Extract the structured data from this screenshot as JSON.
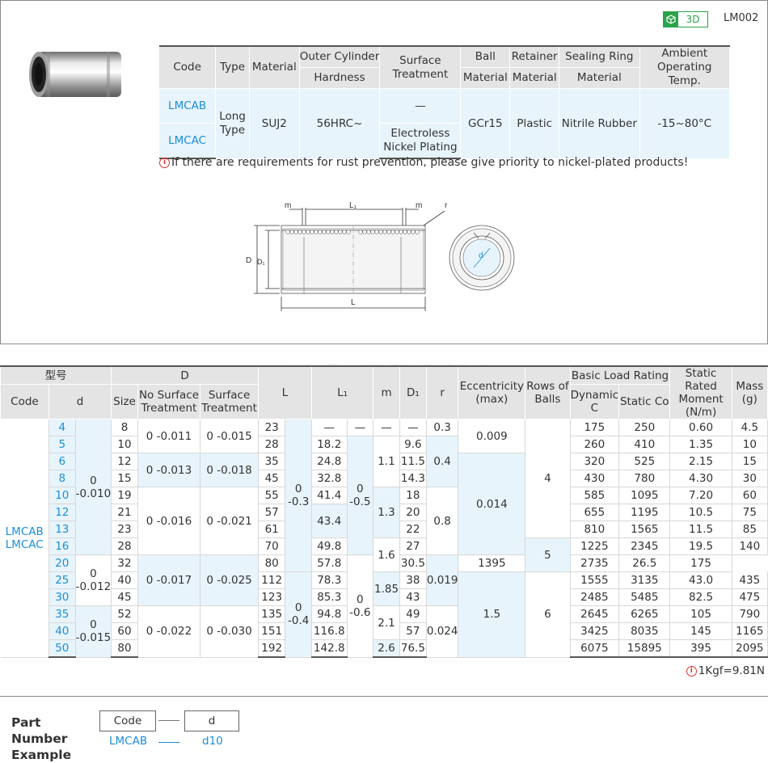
{
  "header": {
    "badge_3d": "3D",
    "product_code": "LM002"
  },
  "spec_table": {
    "headers": {
      "code": "Code",
      "type": "Type",
      "material": "Material",
      "outer_cylinder": "Outer Cylinder",
      "outer_cylinder_sub": "Hardness",
      "surface_treatment": "Surface Treatment",
      "ball": "Ball",
      "ball_sub": "Material",
      "retainer": "Retainer",
      "retainer_sub": "Material",
      "sealing_ring": "Sealing Ring",
      "sealing_ring_sub": "Material",
      "ambient": "Ambient Operating Temp."
    },
    "codes": [
      "LMCAB",
      "LMCAC"
    ],
    "type": "Long Type",
    "material": "SUJ2",
    "hardness": "56HRC~",
    "surface": [
      "—",
      "Electroless Nickel Plating"
    ],
    "ball_material": "GCr15",
    "retainer_material": "Plastic",
    "sealing_material": "Nitrile Rubber",
    "temp": "-15~80°C"
  },
  "note": {
    "icon": "info-icon",
    "text": "If there are requirements for rust prevention, please give priority to nickel-plated products!"
  },
  "drawing_labels": {
    "m": "m",
    "L1": "L₁",
    "r": "r",
    "D": "D",
    "D1": "D₁",
    "L": "L",
    "d": "d"
  },
  "main_table": {
    "headers": {
      "model": "型号",
      "D": "D",
      "code": "Code",
      "d": "d",
      "size": "Size",
      "no_surface": "No Surface Treatment",
      "surface": "Surface Treatment",
      "L": "L",
      "L1": "L₁",
      "m": "m",
      "D1": "D₁",
      "r": "r",
      "eccentricity": "Eccentricity (max)",
      "rows": "Rows of Balls",
      "basic_load": "Basic Load Rating",
      "dynamic": "Dynamic C",
      "static": "Static Co",
      "moment": "Static Rated Moment (N/m)",
      "mass": "Mass (g)"
    },
    "code_label": "LMCAB LMCAC",
    "rows": [
      {
        "d": "4",
        "size": "8",
        "L": "23",
        "L1": "—",
        "L1tol": "—",
        "m": "—",
        "D1": "—",
        "r": "0.3",
        "C": "175",
        "Co": "250",
        "moment": "0.60",
        "mass": "4.5"
      },
      {
        "d": "5",
        "size": "10",
        "L": "28",
        "L1": "18.2",
        "D1": "9.6",
        "C": "260",
        "Co": "410",
        "moment": "1.35",
        "mass": "10"
      },
      {
        "d": "6",
        "size": "12",
        "L": "35",
        "L1": "24.8",
        "D1": "11.5",
        "C": "320",
        "Co": "525",
        "moment": "2.15",
        "mass": "15"
      },
      {
        "d": "8",
        "size": "15",
        "L": "45",
        "L1": "32.8",
        "D1": "14.3",
        "C": "430",
        "Co": "780",
        "moment": "4.30",
        "mass": "30"
      },
      {
        "d": "10",
        "size": "19",
        "L": "55",
        "L1": "41.4",
        "D1": "18",
        "C": "585",
        "Co": "1095",
        "moment": "7.20",
        "mass": "60"
      },
      {
        "d": "12",
        "size": "21",
        "L": "57",
        "D1": "20",
        "C": "655",
        "Co": "1195",
        "moment": "10.5",
        "mass": "75"
      },
      {
        "d": "13",
        "size": "23",
        "L": "61",
        "D1": "22",
        "C": "810",
        "Co": "1565",
        "moment": "11.5",
        "mass": "85"
      },
      {
        "d": "16",
        "size": "28",
        "L": "70",
        "L1": "49.8",
        "D1": "27",
        "C": "1225",
        "Co": "2345",
        "moment": "19.5",
        "mass": "140"
      },
      {
        "d": "20",
        "size": "32",
        "L": "80",
        "L1": "57.8",
        "D1": "30.5",
        "C": "1395",
        "Co": "2735",
        "moment": "26.5",
        "mass": "175"
      },
      {
        "d": "25",
        "size": "40",
        "L": "112",
        "L1": "78.3",
        "D1": "38",
        "C": "1555",
        "Co": "3135",
        "moment": "43.0",
        "mass": "435"
      },
      {
        "d": "30",
        "size": "45",
        "L": "123",
        "L1": "85.3",
        "D1": "43",
        "C": "2485",
        "Co": "5485",
        "moment": "82.5",
        "mass": "475"
      },
      {
        "d": "35",
        "size": "52",
        "L": "135",
        "L1": "94.8",
        "D1": "49",
        "C": "2645",
        "Co": "6265",
        "moment": "105",
        "mass": "790"
      },
      {
        "d": "40",
        "size": "60",
        "L": "151",
        "L1": "116.8",
        "D1": "57",
        "C": "3425",
        "Co": "8035",
        "moment": "145",
        "mass": "1165"
      },
      {
        "d": "50",
        "size": "80",
        "L": "192",
        "L1": "142.8",
        "m": "2.6",
        "D1": "76.5",
        "C": "6075",
        "Co": "15895",
        "moment": "395",
        "mass": "2095"
      }
    ],
    "merged": {
      "dtol_a": "0 -0.010",
      "dtol_b": "0 -0.012",
      "dtol_c": "0 -0.015",
      "ns_a": "0 -0.011",
      "ns_b": "0 -0.013",
      "ns_c": "0 -0.016",
      "ns_d": "0 -0.017",
      "ns_e": "0 -0.022",
      "st_a": "0 -0.015",
      "st_b": "0 -0.018",
      "st_c": "0 -0.021",
      "st_d": "0 -0.025",
      "st_e": "0 -0.030",
      "Ltol_a": "0 -0.3",
      "Ltol_b": "0 -0.4",
      "L1_12_13": "43.4",
      "L1tol_a": "0 -0.5",
      "L1tol_b": "0 -0.6",
      "m_a": "1.1",
      "m_b": "1.3",
      "m_c": "1.6",
      "m_d": "1.85",
      "m_e": "2.1",
      "r_a": "0.4",
      "r_b": "0.8",
      "r_c": "1.5",
      "ecc_a": "0.009",
      "ecc_b": "0.014",
      "ecc_c": "0.019",
      "ecc_d": "0.024",
      "rows_a": "4",
      "rows_b": "5",
      "rows_c": "6"
    }
  },
  "unit_note": {
    "icon": "info-icon",
    "text": "1Kgf=9.81N"
  },
  "part_number": {
    "title": "Part Number Example",
    "box_code": "Code",
    "box_d": "d",
    "ex_code": "LMCAB",
    "ex_d": "d10"
  },
  "colors": {
    "accent_blue": "#1a8fd6",
    "badge_green": "#2aa34a",
    "header_gray": "#e4e4e4",
    "cell_blue": "#e8f4fc"
  }
}
